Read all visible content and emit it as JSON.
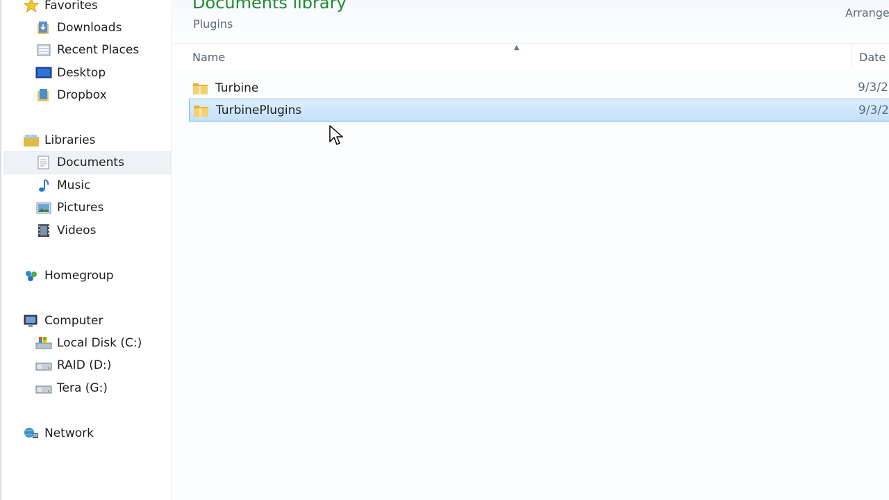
{
  "nav": {
    "favorites": "Favorites",
    "downloads": "Downloads",
    "recent_places": "Recent Places",
    "desktop": "Desktop",
    "dropbox": "Dropbox",
    "libraries": "Libraries",
    "documents": "Documents",
    "music": "Music",
    "pictures": "Pictures",
    "videos": "Videos",
    "homegroup": "Homegroup",
    "computer": "Computer",
    "local_disk": "Local Disk (C:)",
    "raid": "RAID (D:)",
    "tera": "Tera (G:)",
    "network": "Network"
  },
  "content": {
    "title": "Documents library",
    "subtitle": "Plugins",
    "arrange_by": "Arrange",
    "columns": {
      "name": "Name",
      "date": "Date"
    },
    "files": [
      {
        "name": "Turbine",
        "date": "9/3/2"
      },
      {
        "name": "TurbinePlugins",
        "date": "9/3/2"
      }
    ]
  },
  "colors": {
    "title_green": "#1f8b2f",
    "selection": "#c4e0fb",
    "selection_border": "#7eb4ea"
  }
}
